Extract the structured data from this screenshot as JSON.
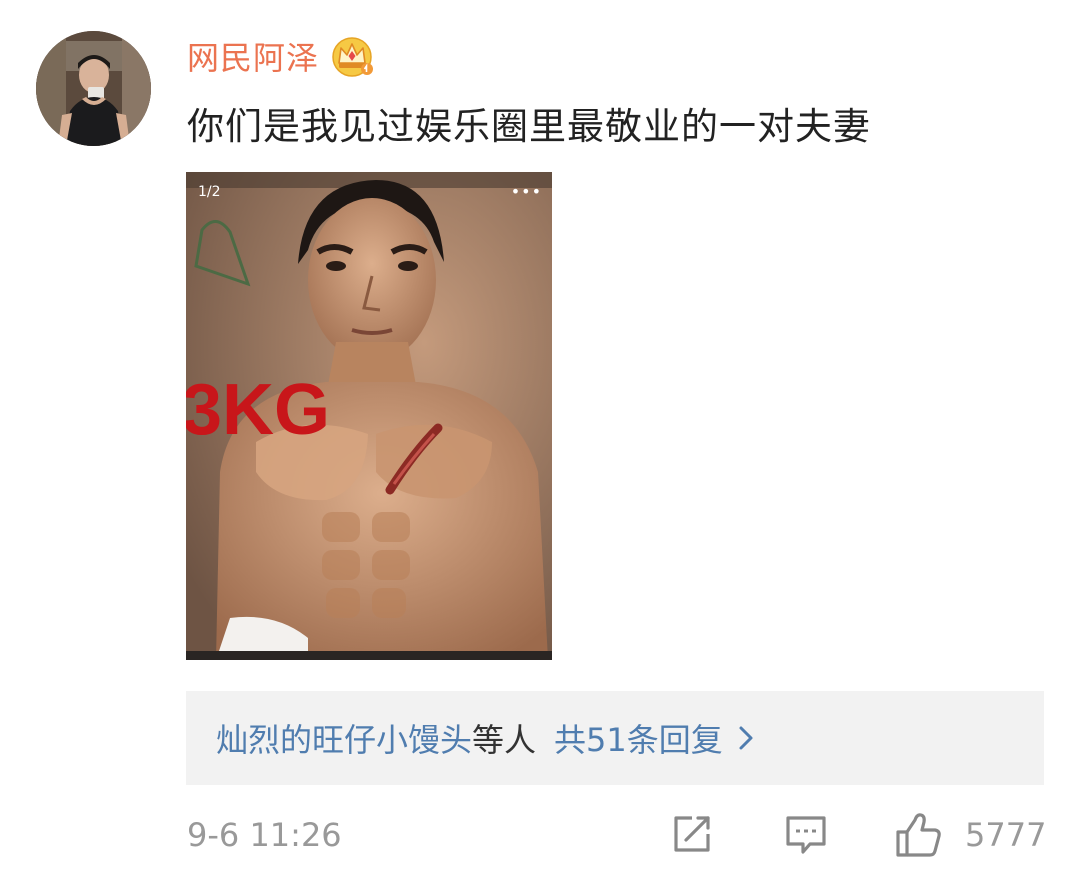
{
  "comment": {
    "username": "网民阿泽",
    "text": "你们是我见过娱乐圈里最敬业的一对夫妻",
    "image": {
      "counter": "1/2",
      "more_label": "•••",
      "overlay_text": "3KG"
    },
    "replies": {
      "names": "灿烈的旺仔小馒头",
      "suffix": "等人",
      "count_text": "共51条回复"
    },
    "timestamp": "9-6 11:26",
    "likes": "5777"
  },
  "icons": {
    "badge": "crown-icon",
    "share": "share-icon",
    "reply": "comment-icon",
    "like": "thumbs-up-icon",
    "expand": "chevron-right-icon"
  },
  "colors": {
    "username": "#eb7350",
    "link": "#507daf",
    "muted": "#999999",
    "reply_bg": "#f2f2f2"
  }
}
